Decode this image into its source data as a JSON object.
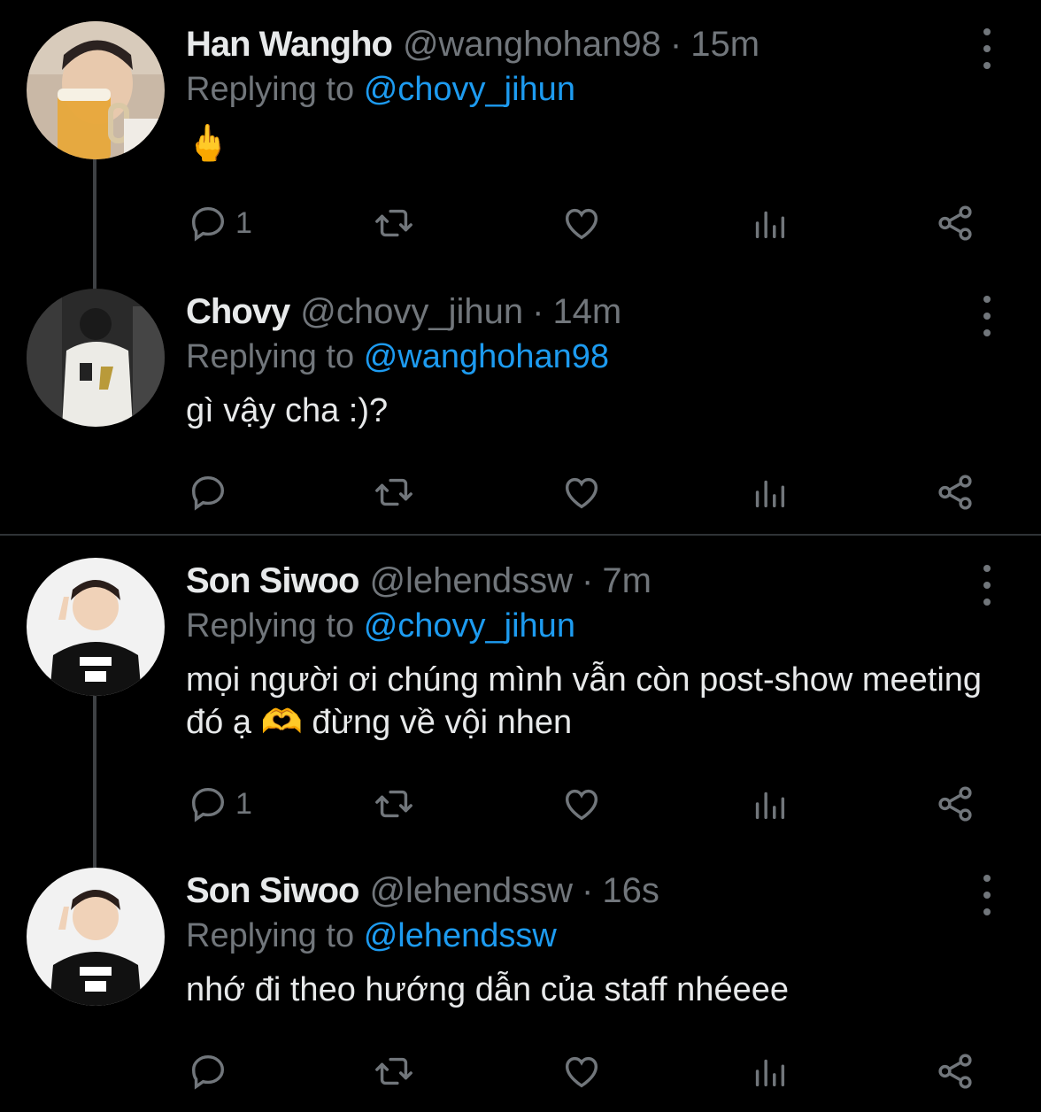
{
  "reply_prefix": "Replying to",
  "tweets": [
    {
      "name": "Han Wangho",
      "handle": "@wanghohan98",
      "sep": "·",
      "time": "15m",
      "reply_to": "@chovy_jihun",
      "text": "🖕",
      "reply_count": "1"
    },
    {
      "name": "Chovy",
      "handle": "@chovy_jihun",
      "sep": "·",
      "time": "14m",
      "reply_to": "@wanghohan98",
      "text": "gì vậy cha :)?",
      "reply_count": ""
    },
    {
      "name": "Son Siwoo",
      "handle": "@lehendssw",
      "sep": "·",
      "time": "7m",
      "reply_to": "@chovy_jihun",
      "text": "mọi người ơi chúng mình vẫn còn post-show meeting đó ạ 🫶 đừng về vội nhen",
      "reply_count": "1"
    },
    {
      "name": "Son Siwoo",
      "handle": "@lehendssw",
      "sep": "·",
      "time": "16s",
      "reply_to": "@lehendssw",
      "text": "nhớ đi theo hướng dẫn của staff nhéeee",
      "reply_count": ""
    }
  ],
  "icons": {
    "reply": "reply-icon",
    "retweet": "retweet-icon",
    "like": "heart-icon",
    "views": "analytics-icon",
    "share": "share-icon",
    "more": "more-options-icon"
  },
  "colors": {
    "background": "#000000",
    "name": "#e7e9ea",
    "secondary": "#71767b",
    "mention": "#1d9bf0",
    "thread_line": "#3e4144",
    "divider": "#2f3336"
  }
}
